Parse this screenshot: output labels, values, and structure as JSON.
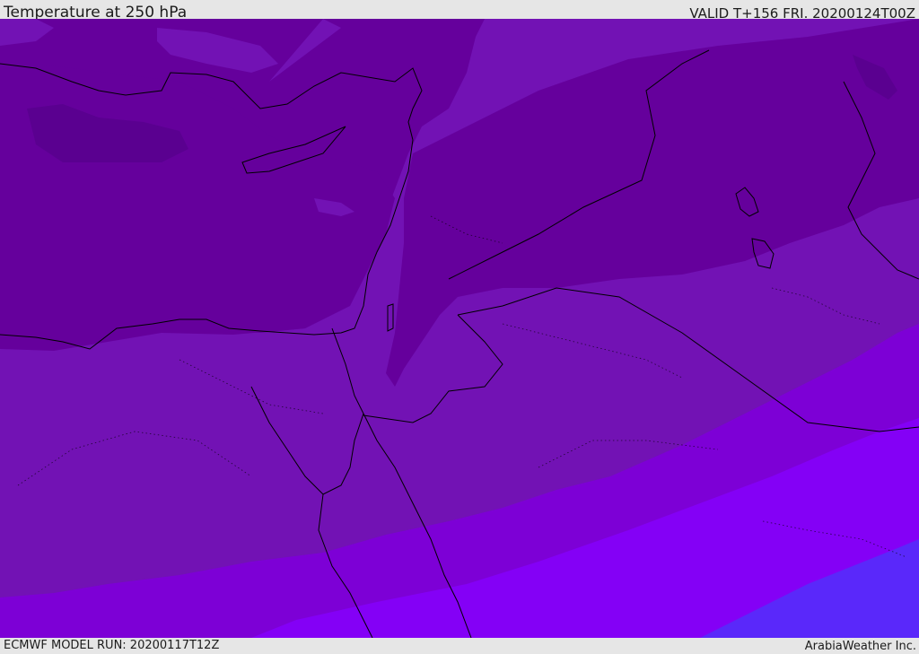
{
  "header": {
    "title": "Temperature at 250 hPa",
    "valid": "VALID T+156 FRI. 20200124T00Z"
  },
  "footer": {
    "model_run": "ECMWF MODEL RUN: 20200117T12Z",
    "credit": "ArabiaWeather Inc."
  },
  "map": {
    "region": "Eastern Mediterranean and Middle East",
    "palette": {
      "band_darkest": "#5a0090",
      "band_dark": "#65009c",
      "band_mid": "#7212b4",
      "band_bright": "#7d00d6",
      "band_violet": "#8400f6",
      "band_blue": "#5a28fa",
      "coastline": "#000000"
    }
  }
}
